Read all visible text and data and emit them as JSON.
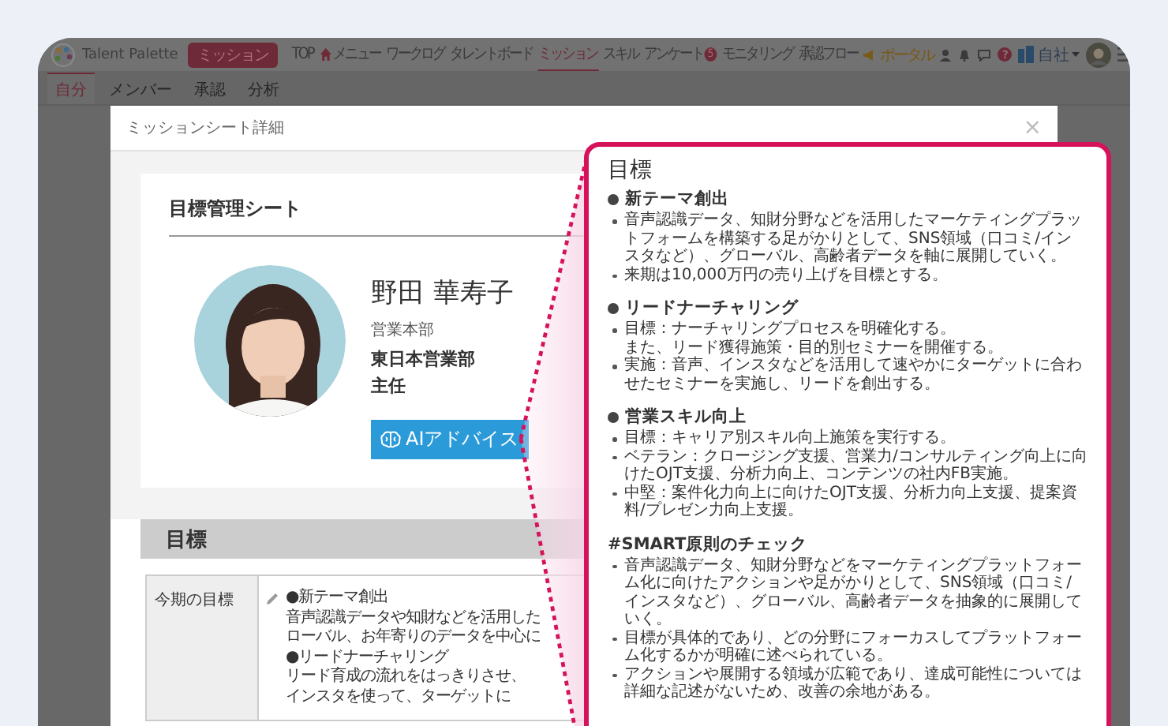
{
  "app": {
    "logo": "Talent Palette",
    "mission_button": "ミッション",
    "nav": [
      {
        "label": "TOP",
        "kind": "text",
        "selected": false
      },
      {
        "label": "メニュー",
        "kind": "home",
        "selected": false
      },
      {
        "label": "ワークログ",
        "kind": "text",
        "selected": false
      },
      {
        "label": "タレントボード",
        "kind": "text",
        "selected": false
      },
      {
        "label": "ミッション",
        "kind": "text",
        "selected": true
      },
      {
        "label": "スキル",
        "kind": "text",
        "selected": false
      },
      {
        "label": "アンケート",
        "kind": "text",
        "selected": false,
        "badge": "5"
      },
      {
        "label": "モニタリング",
        "kind": "text",
        "selected": false
      },
      {
        "label": "承認フロー",
        "kind": "text",
        "selected": false
      }
    ],
    "portal": "ポータル",
    "help": "?",
    "company": "自社"
  },
  "subtabs": [
    {
      "label": "自分",
      "selected": true
    },
    {
      "label": "メンバー",
      "selected": false
    },
    {
      "label": "承認",
      "selected": false
    },
    {
      "label": "分析",
      "selected": false
    }
  ],
  "modal": {
    "title": "ミッションシート詳細",
    "close": "×",
    "sheet_title": "目標管理シート",
    "profile": {
      "name": "野田 華寿子",
      "department": "営業本部",
      "division": "東日本営業部",
      "position": "主任"
    },
    "ai_button": "AIアドバイス",
    "section_title": "目標",
    "rows": [
      {
        "label": "今期の目標",
        "lines": [
          "●新テーマ創出",
          "音声認識データや知財などを活用した",
          "ローバル、お年寄りのデータを中心に",
          "●リードナーチャリング",
          "リード育成の流れをはっきりさせ、",
          "インスタを使って、ターゲットに"
        ]
      }
    ]
  },
  "callout": {
    "title": "目標",
    "sections": [
      {
        "kind": "topic",
        "heading": "新テーマ創出",
        "items": [
          [
            "音声認識データ、知財分野などを活用したマーケティングプラットフォームを構築する足がかりとして、SNS領域（口コミ/インスタなど）、グローバル、高齢者データを軸に展開していく。"
          ],
          [
            "来期は10,000万円の売り上げを目標とする。"
          ]
        ]
      },
      {
        "kind": "topic",
        "heading": "リードナーチャリング",
        "items": [
          [
            "目標：ナーチャリングプロセスを明確化する。",
            "また、リード獲得施策・目的別セミナーを開催する。"
          ],
          [
            "実施：音声、インスタなどを活用して速やかにターゲットに合わせたセミナーを実施し、リードを創出する。"
          ]
        ]
      },
      {
        "kind": "topic",
        "heading": "営業スキル向上",
        "items": [
          [
            "目標：キャリア別スキル向上施策を実行する。"
          ],
          [
            "ベテラン：クロージング支援、営業力/コンサルティング向上に向けたOJT支援、分析力向上、コンテンツの社内FB実施。"
          ],
          [
            "中堅：案件化力向上に向けたOJT支援、分析力向上支援、提案資料/プレゼン力向上支援。"
          ]
        ]
      },
      {
        "kind": "check",
        "heading": "#SMART原則のチェック",
        "items": [
          [
            "音声認識データ、知財分野などをマーケティングプラットフォーム化に向けたアクションや足がかりとして、SNS領域（口コミ/インスタなど）、グローバル、高齢者データを抽象的に展開していく。"
          ],
          [
            "目標が具体的であり、どの分野にフォーカスしてプラットフォーム化するかが明確に述べられている。"
          ],
          [
            "アクションや展開する領域が広範であり、達成可能性については詳細な記述がないため、改善の余地がある。"
          ]
        ]
      }
    ]
  }
}
